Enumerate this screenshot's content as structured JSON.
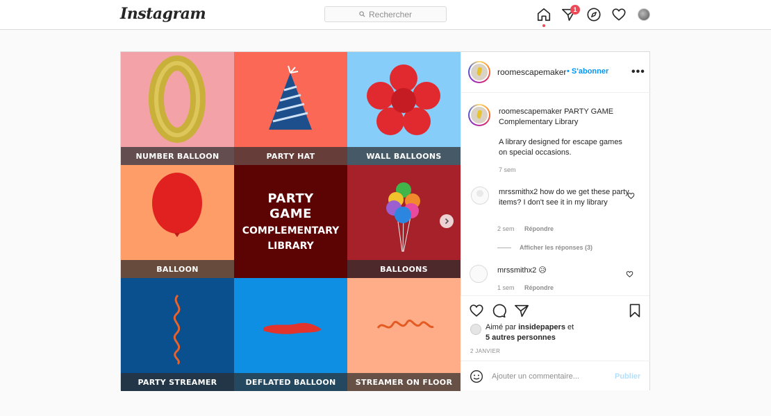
{
  "header": {
    "logo": "Instagram",
    "search_placeholder": "Rechercher",
    "notification_count": "1"
  },
  "media": {
    "tiles": [
      {
        "label": "NUMBER BALLOON",
        "bg": "#f3a2a8"
      },
      {
        "label": "PARTY HAT",
        "bg": "#fb6856"
      },
      {
        "label": "WALL BALLOONS",
        "bg": "#87cdfa"
      },
      {
        "label": "BALLOON",
        "bg": "#ff9d68"
      },
      {
        "label": "",
        "bg": "#5c0303"
      },
      {
        "label": "BALLOONS",
        "bg": "#a6212a"
      },
      {
        "label": "PARTY STREAMER",
        "bg": "#0a4f8e"
      },
      {
        "label": "DEFLATED BALLOON",
        "bg": "#0e8fe4"
      },
      {
        "label": "STREAMER ON FLOOR",
        "bg": "#ffad88"
      }
    ],
    "center_title_1": "PARTY",
    "center_title_2": "GAME",
    "center_sub_1": "COMPLEMENTARY",
    "center_sub_2": "LIBRARY"
  },
  "post": {
    "username": "roomescapemaker",
    "follow_label": "• S'abonner",
    "more": "•••",
    "caption_user": "roomescapemaker",
    "caption_text": "PARTY GAME Complementary Library",
    "caption_body": "A library designed for escape games on special occasions.",
    "caption_time": "7 sem",
    "comments": [
      {
        "user": "mrssmithx2",
        "text": "how do we get these party items? I don't see it in my library",
        "time": "2 sem",
        "reply": "Répondre",
        "view_replies": "Afficher les réponses (3)"
      },
      {
        "user": "mrssmithx2",
        "text": "😥",
        "time": "1 sem",
        "reply": "Répondre"
      }
    ],
    "liked_prefix": "Aimé par",
    "liked_user": "insidepapers",
    "liked_and": "et",
    "liked_others": "5 autres personnes",
    "date": "2 JANVIER",
    "comment_placeholder": "Ajouter un commentaire...",
    "publish_label": "Publier"
  }
}
